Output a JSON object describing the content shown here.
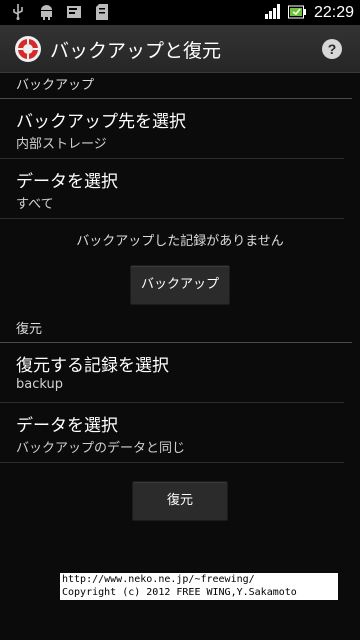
{
  "statusbar": {
    "time": "22:29",
    "icons": [
      "usb-icon",
      "android-icon",
      "notification-icon",
      "sd-card-icon",
      "signal-icon",
      "battery-icon"
    ]
  },
  "actionbar": {
    "title": "バックアップと復元",
    "help_label": "?"
  },
  "backup_section": {
    "header": "バックアップ",
    "destination": {
      "title": "バックアップ先を選択",
      "summary": "内部ストレージ"
    },
    "data_select": {
      "title": "データを選択",
      "summary": "すべて"
    },
    "status_message": "バックアップした記録がありません",
    "button_label": "バックアップ"
  },
  "restore_section": {
    "header": "復元",
    "record_select": {
      "title": "復元する記録を選択",
      "summary": "backup"
    },
    "data_select": {
      "title": "データを選択",
      "summary": "バックアップのデータと同じ"
    },
    "button_label": "復元"
  },
  "footer": {
    "url": "http://www.neko.ne.jp/~freewing/",
    "copyright": "Copyright (c) 2012 FREE WING,Y.Sakamoto"
  },
  "colors": {
    "background": "#0b0b0b",
    "actionbar": "#2d2d2d",
    "divider": "#4a4a4a",
    "app_icon_red": "#d32b2b"
  }
}
